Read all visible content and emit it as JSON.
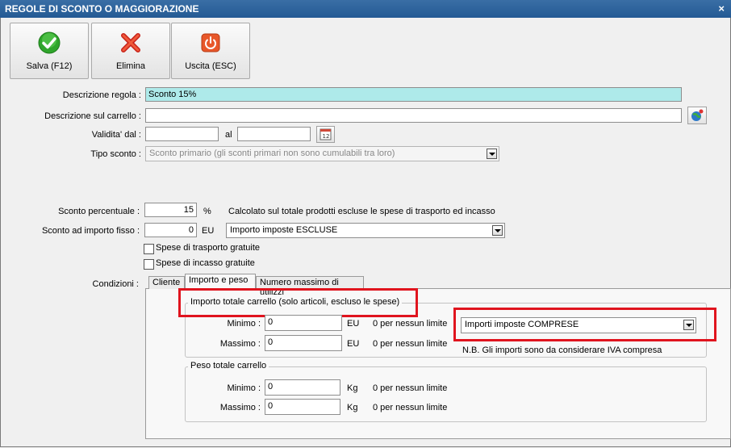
{
  "window": {
    "title": "REGOLE DI SCONTO O MAGGIORAZIONE",
    "close_label": "×"
  },
  "toolbar": {
    "save_label": "Salva (F12)",
    "delete_label": "Elimina",
    "exit_label": "Uscita (ESC)"
  },
  "form": {
    "descrizione_regola": {
      "label": "Descrizione regola :",
      "value": "Sconto 15%"
    },
    "descrizione_carrello": {
      "label": "Descrizione sul carrello :",
      "value": ""
    },
    "validita": {
      "label": "Validita' dal :",
      "from_value": "",
      "to_label": "al",
      "to_value": ""
    },
    "tipo_sconto": {
      "label": "Tipo sconto :",
      "value": "Sconto primario (gli sconti primari non sono cumulabili tra loro)"
    },
    "sconto_percentuale": {
      "label": "Sconto percentuale :",
      "value": "15",
      "unit": "%",
      "note": "Calcolato sul totale prodotti escluse le spese di trasporto ed incasso"
    },
    "sconto_importo": {
      "label": "Sconto ad importo fisso :",
      "value": "0",
      "unit": "EU",
      "tax_option": "Importo imposte ESCLUSE"
    },
    "spese_trasporto": {
      "label": "Spese di trasporto gratuite",
      "checked": false
    },
    "spese_incasso": {
      "label": "Spese di incasso gratuite",
      "checked": false
    },
    "condizioni_label": "Condizioni :"
  },
  "tabs": [
    {
      "label": "Cliente",
      "active": false
    },
    {
      "label": "Importo e peso",
      "active": true
    },
    {
      "label": "Numero massimo di utilizzi",
      "active": false
    }
  ],
  "importo_group": {
    "title": "Importo totale carrello (solo articoli, escluso le spese)",
    "min_label": "Minimo :",
    "min_value": "0",
    "min_unit": "EU",
    "min_hint": "0 per nessun limite",
    "max_label": "Massimo :",
    "max_value": "0",
    "max_unit": "EU",
    "max_hint": "0 per nessun limite",
    "tax_option": "Importi imposte COMPRESE",
    "tax_note": "N.B. Gli importi sono da considerare IVA compresa"
  },
  "peso_group": {
    "title": "Peso totale carrello",
    "min_label": "Minimo :",
    "min_value": "0",
    "min_unit": "Kg",
    "min_hint": "0 per nessun limite",
    "max_label": "Massimo :",
    "max_value": "0",
    "max_unit": "Kg",
    "max_hint": "0 per nessun limite"
  },
  "colors": {
    "highlight_input": "#aeeaea",
    "title_bar": "#245a94",
    "annotation_red": "#e0141e"
  }
}
